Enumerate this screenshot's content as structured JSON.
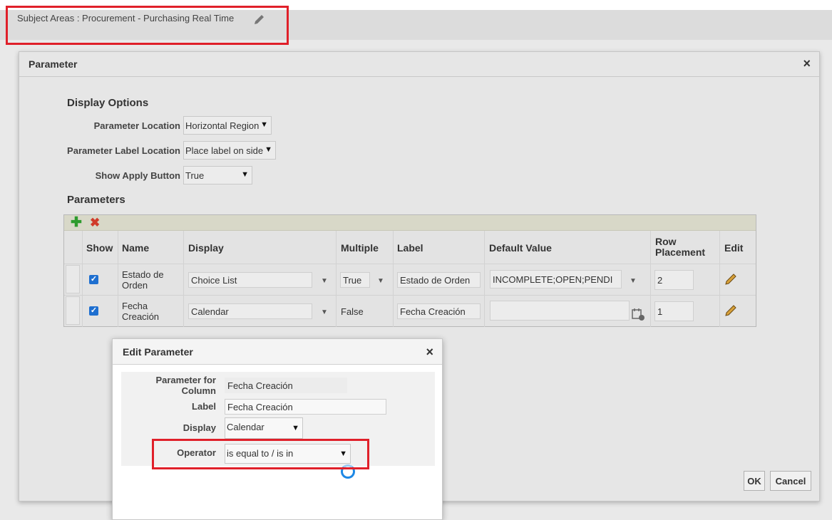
{
  "header": {
    "subject_area": "Subject Areas : Procurement - Purchasing Real Time",
    "edit_icon": "pencil-icon"
  },
  "dialog": {
    "title": "Parameter",
    "close": "×",
    "display_options": {
      "heading": "Display Options",
      "location_label": "Parameter Location",
      "location_value": "Horizontal Region",
      "label_location_label": "Parameter Label Location",
      "label_location_value": "Place label on side",
      "apply_label": "Show Apply Button",
      "apply_value": "True"
    },
    "parameters": {
      "heading": "Parameters",
      "add_icon": "plus-icon",
      "delete_icon": "delete-x-icon",
      "columns": [
        "Show",
        "Name",
        "Display",
        "Multiple",
        "Label",
        "Default Value",
        "Row Placement",
        "Edit"
      ],
      "rows": [
        {
          "name": "Estado de Orden",
          "display": "Choice List",
          "multiple": "True",
          "label": "Estado de Orden",
          "default_value": "INCOMPLETE;OPEN;PENDI",
          "row_placement": "2"
        },
        {
          "name": "Fecha Creación",
          "display": "Calendar",
          "multiple": "False",
          "label": "Fecha Creación",
          "default_value": "",
          "row_placement": "1"
        }
      ]
    },
    "ok": "OK",
    "cancel": "Cancel"
  },
  "edit_parameter": {
    "title": "Edit Parameter",
    "close": "×",
    "column_label": "Parameter for Column",
    "column_value": "Fecha Creación",
    "label_label": "Label",
    "label_value": "Fecha Creación",
    "display_label": "Display",
    "display_value": "Calendar",
    "operator_label": "Operator",
    "operator_value": "is equal to / is in"
  },
  "colors": {
    "highlight": "#e0202a",
    "add": "#2e9b2e",
    "delete": "#d03b2a",
    "checkbox": "#1e6fd0"
  }
}
